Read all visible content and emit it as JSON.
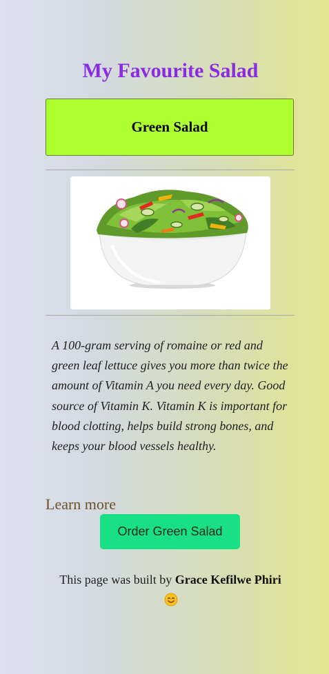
{
  "header": {
    "title": "My Favourite Salad"
  },
  "salad": {
    "name": "Green Salad",
    "image_icon": "salad-bowl-photo",
    "description": "A 100-gram serving of romaine or red and green leaf lettuce gives you more than twice the amount of Vitamin A you need every day. Good source of Vitamin K. Vitamin K is important for blood clotting, helps build strong bones, and keeps your blood vessels healthy."
  },
  "actions": {
    "learn_more_label": "Learn more",
    "order_label": "Order Green Salad"
  },
  "footer": {
    "prefix": "This page was built by",
    "author": "Grace Kefilwe Phiri",
    "emoji_icon": "smiling-face-icon"
  },
  "colors": {
    "title": "#8a2be2",
    "name_box": "#adff2f",
    "order_button": "#19df85",
    "learn_more": "#6b5128"
  }
}
